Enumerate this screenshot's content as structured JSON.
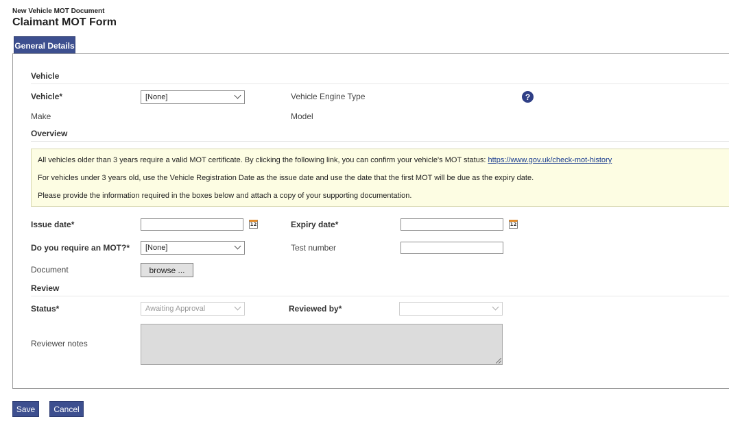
{
  "header": {
    "subtitle": "New Vehicle MOT Document",
    "title": "Claimant MOT Form"
  },
  "tabs": [
    {
      "label": "General Details",
      "active": true
    }
  ],
  "sections": {
    "vehicle": "Vehicle",
    "overview": "Overview",
    "review": "Review"
  },
  "vehicle": {
    "vehicle_label": "Vehicle*",
    "vehicle_value": "[None]",
    "engine_type_label": "Vehicle Engine Type",
    "help_icon": "?",
    "make_label": "Make",
    "model_label": "Model"
  },
  "notice": {
    "line1": "All vehicles older than 3 years require a valid MOT certificate. By clicking the following link, you can confirm your vehicle's MOT status: ",
    "link": "https://www.gov.uk/check-mot-history",
    "line2": "For vehicles under 3 years old, use the Vehicle Registration Date as the issue date and use the date that the first MOT will be due as the expiry date.",
    "line3": "Please provide the information required in the boxes below and attach a copy of your supporting documentation."
  },
  "overview": {
    "issue_date_label": "Issue date*",
    "issue_date_value": "",
    "expiry_date_label": "Expiry date*",
    "expiry_date_value": "",
    "calendar_day": "12",
    "require_mot_label": "Do you require an MOT?*",
    "require_mot_value": "[None]",
    "test_number_label": "Test number",
    "test_number_value": "",
    "document_label": "Document",
    "browse_label": "browse ..."
  },
  "review": {
    "status_label": "Status*",
    "status_value": "Awaiting Approval",
    "reviewed_by_label": "Reviewed by*",
    "reviewed_by_value": "",
    "reviewer_notes_label": "Reviewer notes"
  },
  "actions": {
    "save_label": "Save",
    "cancel_label": "Cancel"
  },
  "colors": {
    "primary": "#3d4f8f",
    "notice_bg": "#fdfde3",
    "calendar_accent": "#e08a2a"
  }
}
